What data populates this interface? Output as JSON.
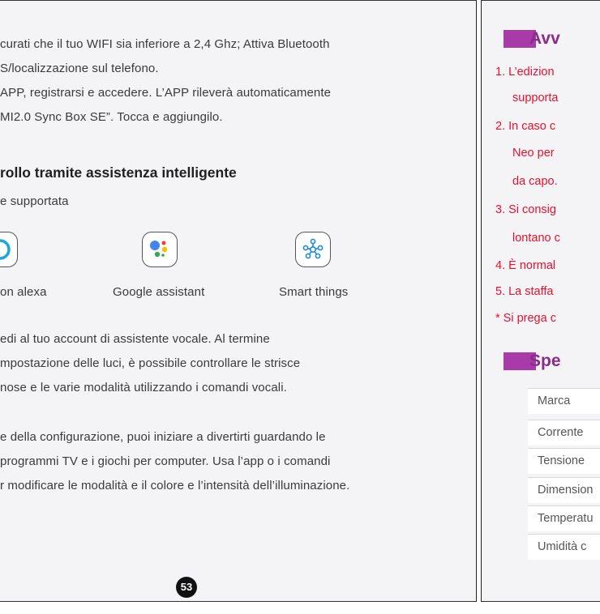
{
  "left": {
    "lines": [
      "curati che il tuo WIFI sia inferiore a 2,4 Ghz; Attiva Bluetooth",
      "S/localizzazione sul telefono.",
      "APP, registrarsi e accedere. L’APP rileverà automaticamente",
      "MI2.0 Sync Box SE”. Tocca e aggiungilo."
    ],
    "heading": "rollo tramite assistenza intelligente",
    "supported": "e supportata",
    "assistants": [
      {
        "label": "on alexa",
        "icon": "alexa-icon"
      },
      {
        "label": "Google assistant",
        "icon": "google-assistant-icon"
      },
      {
        "label": "Smart things",
        "icon": "smart-things-icon"
      }
    ],
    "para1": [
      "edi al tuo account di assistente vocale. Al termine",
      "mpostazione delle luci, è possibile controllare le strisce",
      "nose e le varie modalità utilizzando i comandi vocali."
    ],
    "para2": [
      "e della configurazione, puoi iniziare a divertirti guardando le",
      "programmi TV e i giochi per computer. Usa l’app o i comandi",
      "r modificare le modalità e il colore e l’intensità dell’illuminazione."
    ],
    "page_number": "53"
  },
  "right": {
    "heading1": "Avv",
    "notes": [
      "1. L’edizion",
      "supporta",
      "2. In caso c",
      "Neo per",
      "da capo.",
      "3. Si consig",
      "lontano c",
      "4. È normal",
      "5. La staffa",
      "* Si prega c"
    ],
    "heading2": "Spe",
    "spec_rows": [
      "Marca",
      "Corrente",
      "Tensione",
      "Dimension",
      "Temperatu",
      "Umidità c"
    ]
  },
  "colors": {
    "accent": "#a93aa9",
    "warning_text": "#e8112d",
    "page_bg": "#f4f4f6"
  }
}
